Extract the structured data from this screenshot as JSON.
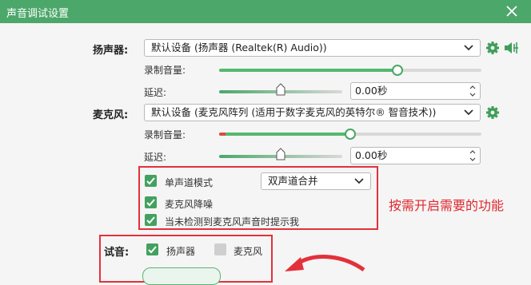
{
  "window": {
    "title": "声音调试设置"
  },
  "speaker": {
    "label": "扬声器:",
    "device": "默认设备 (扬声器 (Realtek(R) Audio))",
    "volume_label": "录制音量:",
    "volume_level": 0.68,
    "delay_label": "延迟:",
    "delay_value": "0.00秒"
  },
  "mic": {
    "label": "麦克风:",
    "device": "默认设备 (麦克风阵列 (适用于数字麦克风的英特尔® 智音技术))",
    "volume_label": "录制音量:",
    "volume_level": 0.5,
    "delay_label": "延迟:",
    "delay_value": "0.00秒"
  },
  "options": {
    "mono_label": "单声道模式",
    "mono_checked": true,
    "mono_select": "双声道合并",
    "noise_label": "麦克风降噪",
    "noise_checked": true,
    "notify_label": "当未检测到麦克风声音时提示我",
    "notify_checked": true
  },
  "annotation": {
    "text": "按需开启需要的功能"
  },
  "test": {
    "label": "试音:",
    "speaker_label": "扬声器",
    "speaker_checked": true,
    "mic_label": "麦克风",
    "mic_checked": false
  },
  "colors": {
    "accent": "#4ca76a",
    "annotation_red": "#e3313a"
  }
}
